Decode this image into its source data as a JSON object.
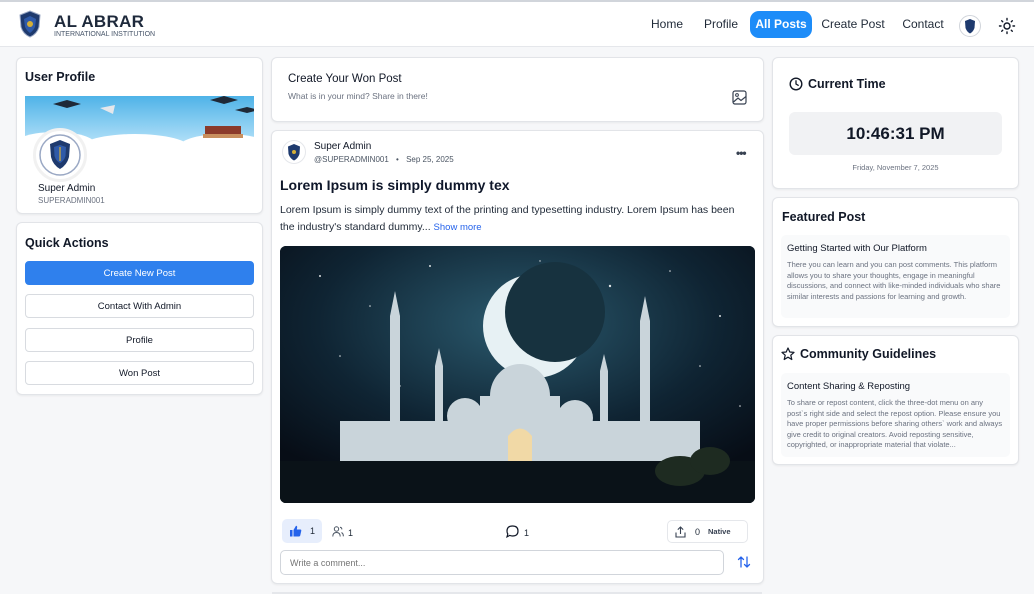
{
  "header": {
    "brand_name": "AL ABRAR",
    "brand_sub": "INTERNATIONAL INSTITUTION",
    "nav": [
      "Home",
      "Profile",
      "All Posts",
      "Create Post",
      "Contact"
    ],
    "active_nav": "All Posts",
    "accent_color": "#1d8cf8",
    "icons": [
      "logo-badge",
      "avatar",
      "sun-icon"
    ]
  },
  "user_profile": {
    "title": "User Profile",
    "name": "Super Admin",
    "handle": "SUPERADMIN001"
  },
  "quick_actions": {
    "title": "Quick Actions",
    "buttons": [
      "Create New Post",
      "Contact With Admin",
      "Profile",
      "Won Post"
    ]
  },
  "create_post": {
    "title": "Create Your Won Post",
    "placeholder": "What is in your mind? Share in there!"
  },
  "post": {
    "author": "Super Admin",
    "handle": "@SUPERADMIN001",
    "separator": "•",
    "date": "Sep 25, 2025",
    "title": "Lorem Ipsum is simply dummy tex",
    "body": "Lorem Ipsum is simply dummy text of the printing and typesetting industry. Lorem Ipsum has been the industry's standard dummy...",
    "show_more": "Show more",
    "likes": "1",
    "reactors": "1",
    "comments": "1",
    "shares": "0",
    "share_badge": "Native",
    "comment_placeholder": "Write a comment..."
  },
  "current_time": {
    "title": "Current Time",
    "time": "10:46:31 PM",
    "date": "Friday, November 7, 2025"
  },
  "featured_post": {
    "title": "Featured Post",
    "item_title": "Getting Started with Our Platform",
    "item_text": "There you can learn and you can post comments. This platform allows you to share your thoughts, engage in meaningful discussions, and connect with like-minded individuals who share similar interests and passions for learning and growth."
  },
  "guidelines": {
    "title": "Community Guidelines",
    "item_title": "Content Sharing & Reposting",
    "item_text": "To share or repost content, click the three-dot menu on any post`s right side and select the repost option. Please ensure you have proper permissions before sharing others` work and always give credit to original creators. Avoid reposting sensitive, copyrighted, or inappropriate material that violate..."
  }
}
